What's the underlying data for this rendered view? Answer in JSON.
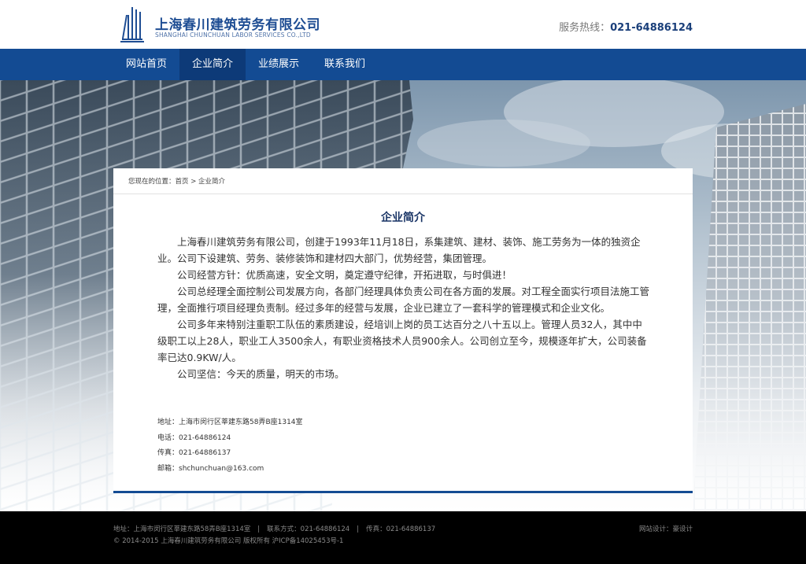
{
  "header": {
    "company_cn": "上海春川建筑劳务有限公司",
    "company_en": "SHANGHAI CHUNCHUAN LABOR SERVICES CO.,LTD",
    "hotline_label": "服务热线：",
    "hotline_number": "021-64886124",
    "logo_icon": "building-logo-icon",
    "brand_color": "#134b93"
  },
  "nav": {
    "items": [
      {
        "label": "网站首页",
        "active": false
      },
      {
        "label": "企业简介",
        "active": true
      },
      {
        "label": "业绩展示",
        "active": false
      },
      {
        "label": "联系我们",
        "active": false
      }
    ]
  },
  "breadcrumb": {
    "text": "您现在的位置：首页 > 企业简介"
  },
  "main": {
    "title": "企业简介",
    "paragraphs": [
      "上海春川建筑劳务有限公司，创建于1993年11月18日，系集建筑、建材、装饰、施工劳务为一体的独资企业。公司下设建筑、劳务、装修装饰和建材四大部门，优势经营，集团管理。",
      "公司经营方针：优质高速，安全文明，奠定遵守纪律，开拓进取，与时俱进！",
      "公司总经理全面控制公司发展方向，各部门经理具体负责公司在各方面的发展。对工程全面实行项目法施工管理，全面推行项目经理负责制。经过多年的经营与发展，企业已建立了一套科学的管理模式和企业文化。",
      "公司多年来特别注重职工队伍的素质建设，经培训上岗的员工达百分之八十五以上。管理人员32人，其中中级职工以上28人，职业工人3500余人，有职业资格技术人员900余人。公司创立至今，规模逐年扩大，公司装备率已达0.9KW/人。",
      "公司坚信：今天的质量，明天的市场。"
    ]
  },
  "contact": {
    "address": "地址：上海市闵行区莘建东路58弄B座1314室",
    "phone": "电话：021-64886124",
    "fax": "传真：021-64886137",
    "email": "邮箱：shchunchuan@163.com"
  },
  "footer": {
    "address": "地址：上海市闵行区莘建东路58弄B座1314室",
    "contact": "联系方式：021-64886124",
    "fax": "传真：021-64886137",
    "copyright": "© 2014-2015 上海春川建筑劳务有限公司 版权所有 沪ICP备14025453号-1",
    "design": "网站设计：豪设计"
  }
}
